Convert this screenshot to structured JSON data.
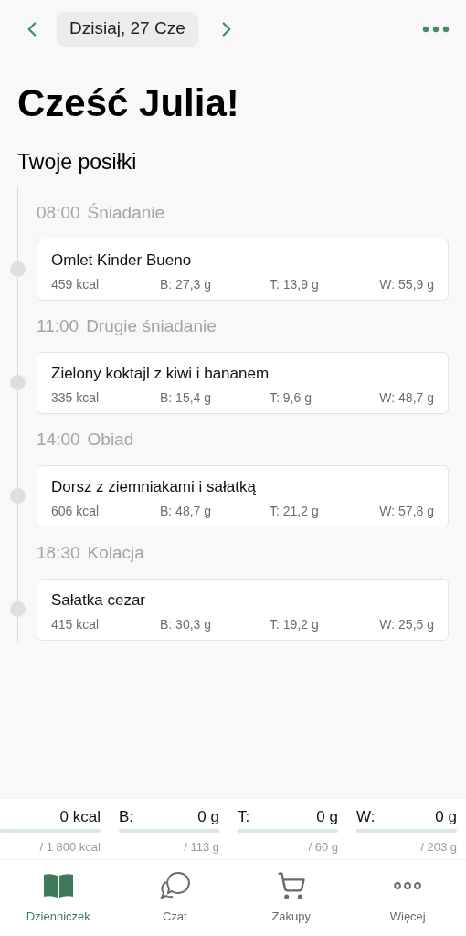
{
  "header": {
    "date": "Dzisiaj, 27 Cze"
  },
  "greeting": "Cześć Julia!",
  "section_title": "Twoje posiłki",
  "meals": [
    {
      "time": "08:00",
      "name": "Śniadanie",
      "dish": "Omlet Kinder Bueno",
      "kcal": "459 kcal",
      "protein": "B: 27,3 g",
      "fat": "T: 13,9 g",
      "carbs": "W: 55,9 g"
    },
    {
      "time": "11:00",
      "name": "Drugie śniadanie",
      "dish": "Zielony koktajl z kiwi i bananem",
      "kcal": "335 kcal",
      "protein": "B: 15,4 g",
      "fat": "T: 9,6 g",
      "carbs": "W: 48,7 g"
    },
    {
      "time": "14:00",
      "name": "Obiad",
      "dish": "Dorsz z ziemniakami i sałatką",
      "kcal": "606 kcal",
      "protein": "B: 48,7 g",
      "fat": "T: 21,2 g",
      "carbs": "W: 57,8 g"
    },
    {
      "time": "18:30",
      "name": "Kolacja",
      "dish": "Sałatka cezar",
      "kcal": "415 kcal",
      "protein": "B: 30,3 g",
      "fat": "T: 19,2 g",
      "carbs": "W: 25,5 g"
    }
  ],
  "summary": [
    {
      "value": "0 kcal",
      "target": "/ 1 800 kcal"
    },
    {
      "label": "B:",
      "value": "0 g",
      "target": "/ 113 g"
    },
    {
      "label": "T:",
      "value": "0 g",
      "target": "/ 60 g"
    },
    {
      "label": "W:",
      "value": "0 g",
      "target": "/ 203 g"
    }
  ],
  "tabs": [
    {
      "kind": "book",
      "label": "Dzienniczek",
      "selected": true
    },
    {
      "kind": "chat",
      "label": "Czat",
      "selected": false
    },
    {
      "kind": "cart",
      "label": "Zakupy",
      "selected": false
    },
    {
      "kind": "more",
      "label": "Więcej",
      "selected": false
    }
  ]
}
